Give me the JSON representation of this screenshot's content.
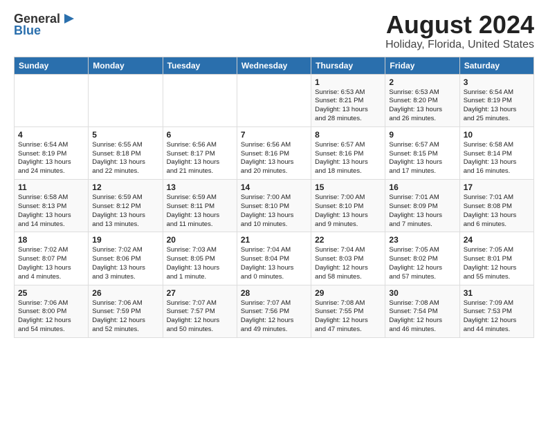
{
  "logo": {
    "general": "General",
    "blue": "Blue",
    "icon": "▶"
  },
  "title": "August 2024",
  "subtitle": "Holiday, Florida, United States",
  "days_header": [
    "Sunday",
    "Monday",
    "Tuesday",
    "Wednesday",
    "Thursday",
    "Friday",
    "Saturday"
  ],
  "weeks": [
    {
      "cells": [
        {
          "day": "",
          "info": ""
        },
        {
          "day": "",
          "info": ""
        },
        {
          "day": "",
          "info": ""
        },
        {
          "day": "",
          "info": ""
        },
        {
          "day": "1",
          "info": "Sunrise: 6:53 AM\nSunset: 8:21 PM\nDaylight: 13 hours\nand 28 minutes."
        },
        {
          "day": "2",
          "info": "Sunrise: 6:53 AM\nSunset: 8:20 PM\nDaylight: 13 hours\nand 26 minutes."
        },
        {
          "day": "3",
          "info": "Sunrise: 6:54 AM\nSunset: 8:19 PM\nDaylight: 13 hours\nand 25 minutes."
        }
      ]
    },
    {
      "cells": [
        {
          "day": "4",
          "info": "Sunrise: 6:54 AM\nSunset: 8:19 PM\nDaylight: 13 hours\nand 24 minutes."
        },
        {
          "day": "5",
          "info": "Sunrise: 6:55 AM\nSunset: 8:18 PM\nDaylight: 13 hours\nand 22 minutes."
        },
        {
          "day": "6",
          "info": "Sunrise: 6:56 AM\nSunset: 8:17 PM\nDaylight: 13 hours\nand 21 minutes."
        },
        {
          "day": "7",
          "info": "Sunrise: 6:56 AM\nSunset: 8:16 PM\nDaylight: 13 hours\nand 20 minutes."
        },
        {
          "day": "8",
          "info": "Sunrise: 6:57 AM\nSunset: 8:16 PM\nDaylight: 13 hours\nand 18 minutes."
        },
        {
          "day": "9",
          "info": "Sunrise: 6:57 AM\nSunset: 8:15 PM\nDaylight: 13 hours\nand 17 minutes."
        },
        {
          "day": "10",
          "info": "Sunrise: 6:58 AM\nSunset: 8:14 PM\nDaylight: 13 hours\nand 16 minutes."
        }
      ]
    },
    {
      "cells": [
        {
          "day": "11",
          "info": "Sunrise: 6:58 AM\nSunset: 8:13 PM\nDaylight: 13 hours\nand 14 minutes."
        },
        {
          "day": "12",
          "info": "Sunrise: 6:59 AM\nSunset: 8:12 PM\nDaylight: 13 hours\nand 13 minutes."
        },
        {
          "day": "13",
          "info": "Sunrise: 6:59 AM\nSunset: 8:11 PM\nDaylight: 13 hours\nand 11 minutes."
        },
        {
          "day": "14",
          "info": "Sunrise: 7:00 AM\nSunset: 8:10 PM\nDaylight: 13 hours\nand 10 minutes."
        },
        {
          "day": "15",
          "info": "Sunrise: 7:00 AM\nSunset: 8:10 PM\nDaylight: 13 hours\nand 9 minutes."
        },
        {
          "day": "16",
          "info": "Sunrise: 7:01 AM\nSunset: 8:09 PM\nDaylight: 13 hours\nand 7 minutes."
        },
        {
          "day": "17",
          "info": "Sunrise: 7:01 AM\nSunset: 8:08 PM\nDaylight: 13 hours\nand 6 minutes."
        }
      ]
    },
    {
      "cells": [
        {
          "day": "18",
          "info": "Sunrise: 7:02 AM\nSunset: 8:07 PM\nDaylight: 13 hours\nand 4 minutes."
        },
        {
          "day": "19",
          "info": "Sunrise: 7:02 AM\nSunset: 8:06 PM\nDaylight: 13 hours\nand 3 minutes."
        },
        {
          "day": "20",
          "info": "Sunrise: 7:03 AM\nSunset: 8:05 PM\nDaylight: 13 hours\nand 1 minute."
        },
        {
          "day": "21",
          "info": "Sunrise: 7:04 AM\nSunset: 8:04 PM\nDaylight: 13 hours\nand 0 minutes."
        },
        {
          "day": "22",
          "info": "Sunrise: 7:04 AM\nSunset: 8:03 PM\nDaylight: 12 hours\nand 58 minutes."
        },
        {
          "day": "23",
          "info": "Sunrise: 7:05 AM\nSunset: 8:02 PM\nDaylight: 12 hours\nand 57 minutes."
        },
        {
          "day": "24",
          "info": "Sunrise: 7:05 AM\nSunset: 8:01 PM\nDaylight: 12 hours\nand 55 minutes."
        }
      ]
    },
    {
      "cells": [
        {
          "day": "25",
          "info": "Sunrise: 7:06 AM\nSunset: 8:00 PM\nDaylight: 12 hours\nand 54 minutes."
        },
        {
          "day": "26",
          "info": "Sunrise: 7:06 AM\nSunset: 7:59 PM\nDaylight: 12 hours\nand 52 minutes."
        },
        {
          "day": "27",
          "info": "Sunrise: 7:07 AM\nSunset: 7:57 PM\nDaylight: 12 hours\nand 50 minutes."
        },
        {
          "day": "28",
          "info": "Sunrise: 7:07 AM\nSunset: 7:56 PM\nDaylight: 12 hours\nand 49 minutes."
        },
        {
          "day": "29",
          "info": "Sunrise: 7:08 AM\nSunset: 7:55 PM\nDaylight: 12 hours\nand 47 minutes."
        },
        {
          "day": "30",
          "info": "Sunrise: 7:08 AM\nSunset: 7:54 PM\nDaylight: 12 hours\nand 46 minutes."
        },
        {
          "day": "31",
          "info": "Sunrise: 7:09 AM\nSunset: 7:53 PM\nDaylight: 12 hours\nand 44 minutes."
        }
      ]
    }
  ]
}
